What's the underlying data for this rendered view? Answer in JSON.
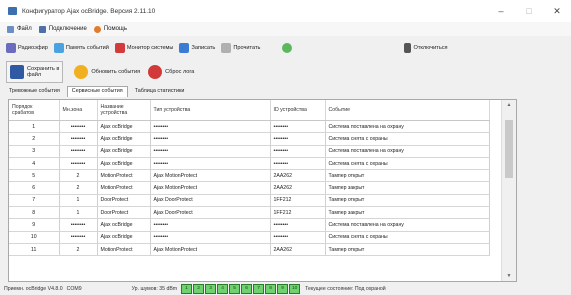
{
  "window": {
    "title": "Конфигуратор Ajax ocBridge. Версия 2.11.10",
    "minimize": "–",
    "maximize": "□",
    "close": "✕"
  },
  "menu": {
    "items": [
      {
        "label": "Файл",
        "icon": "file-icon",
        "color": "#6a8fc4"
      },
      {
        "label": "Подключение",
        "icon": "plug-icon",
        "color": "#4f6fa8"
      },
      {
        "label": "Помощь",
        "icon": "help-icon",
        "color": "#e07b2f"
      }
    ]
  },
  "toolbar": {
    "items": [
      {
        "label": "Радиоэфир",
        "icon": "wrench-icon",
        "color": "#6b6bbf"
      },
      {
        "label": "Память событий",
        "icon": "memory-icon",
        "color": "#4aa3e0"
      },
      {
        "label": "Монитор системы",
        "icon": "monitor-icon",
        "color": "#d33b3b"
      },
      {
        "label": "Записать",
        "icon": "download-icon",
        "color": "#3a7bd5"
      },
      {
        "label": "Прочитать",
        "icon": "upload-icon",
        "color": "#b0b0b0"
      },
      {
        "label": "",
        "icon": "check-icon",
        "color": "#5cb85c"
      },
      {
        "label": "Отключиться",
        "icon": "disconnect-icon",
        "color": "#555555"
      }
    ]
  },
  "toolbar2": {
    "save": {
      "label_line1": "Сохранить в",
      "label_line2": "файл",
      "icon": "save-icon",
      "color": "#2f5aa3"
    },
    "refresh": {
      "label": "Обновить события",
      "icon": "refresh-icon",
      "color": "#f0b020"
    },
    "reset": {
      "label": "Сброс лога",
      "icon": "reset-icon",
      "color": "#d23a3a"
    }
  },
  "tabs": [
    {
      "label": "Тревожные события",
      "active": false
    },
    {
      "label": "Сервисные события",
      "active": true
    },
    {
      "label": "Таблица статистики",
      "active": false
    }
  ],
  "grid": {
    "headers": [
      "Порядок срабатов",
      "Мн.зона",
      "Название устройства",
      "Тип устройства",
      "ID устройства",
      "Событие"
    ],
    "rows": [
      [
        "1",
        "••••••••",
        "Ajax ocBridge",
        "••••••••",
        "••••••••",
        "Система поставлена на охрану"
      ],
      [
        "2",
        "••••••••",
        "Ajax ocBridge",
        "••••••••",
        "••••••••",
        "Система снята с охраны"
      ],
      [
        "3",
        "••••••••",
        "Ajax ocBridge",
        "••••••••",
        "••••••••",
        "Система поставлена на охрану"
      ],
      [
        "4",
        "••••••••",
        "Ajax ocBridge",
        "••••••••",
        "••••••••",
        "Система снята с охраны"
      ],
      [
        "5",
        "2",
        "MotionProtect",
        "Ajax MotionProtect",
        "2AA262",
        "Тампер открыт"
      ],
      [
        "6",
        "2",
        "MotionProtect",
        "Ajax MotionProtect",
        "2AA262",
        "Тампер закрыт"
      ],
      [
        "7",
        "1",
        "DoorProtect",
        "Ajax DoorProtect",
        "1FF212",
        "Тампер открыт"
      ],
      [
        "8",
        "1",
        "DoorProtect",
        "Ajax DoorProtect",
        "1FF212",
        "Тампер закрыт"
      ],
      [
        "9",
        "••••••••",
        "Ajax ocBridge",
        "••••••••",
        "••••••••",
        "Система поставлена на охрану"
      ],
      [
        "10",
        "••••••••",
        "Ajax ocBridge",
        "••••••••",
        "••••••••",
        "Система снята с охраны"
      ],
      [
        "11",
        "2",
        "MotionProtect",
        "Ajax MotionProtect",
        "2AA262",
        "Тампер открыт"
      ]
    ]
  },
  "statusbar": {
    "text1": "Приемн. ocBridge V4.8.0",
    "text2": "COM9",
    "text3": "Ур. шумов: 35 dBm",
    "zones": [
      "1",
      "2",
      "3",
      "4",
      "5",
      "6",
      "7",
      "8",
      "9",
      "10"
    ],
    "text4": "Текущее состояние: Под охраной"
  },
  "colors": {
    "selection": "#3d9be9",
    "led_on": "#6fd26f"
  }
}
